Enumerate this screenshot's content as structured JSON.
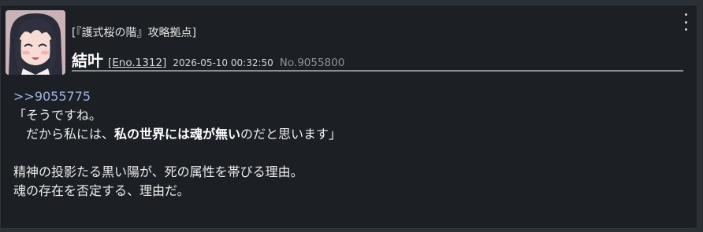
{
  "post": {
    "group_label": "[『護式桜の階』攻略拠点]",
    "character_name": "結叶",
    "eno_open": "[",
    "eno_link": "Eno.1312",
    "eno_close": "]",
    "timestamp": "2026-05-10 00:32:50",
    "post_number": "No.9055800",
    "reply_ref": ">>9055775",
    "lines": [
      "「そうですね。",
      "　だから私には、",
      "私の世界には魂が無い",
      "のだと思います」",
      "精神の投影たる黒い陽が、死の属性を帯びる理由。",
      "魂の存在を否定する、理由だ。"
    ]
  }
}
